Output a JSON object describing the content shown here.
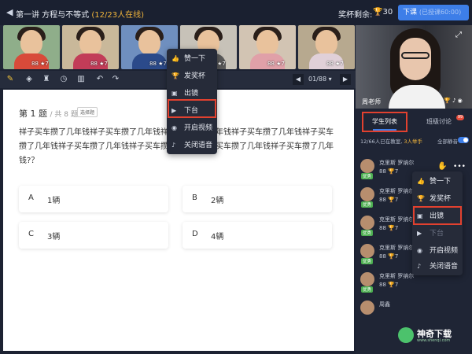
{
  "header": {
    "back_icon": "back-icon",
    "lesson_label": "第一讲 方程与不等式",
    "online_count": "(12/23人在线)",
    "cups_label": "奖杯剩余:",
    "cups_count": "30",
    "end_button": "下课",
    "end_button_sub": "(已授课60:00)"
  },
  "video_strip": {
    "thumbs": [
      {
        "stats": "88 ★7",
        "bg": "#8fae8a",
        "shirt": "#d84a3a"
      },
      {
        "stats": "88 ★7",
        "bg": "#c9b89a",
        "shirt": "#c23c58"
      },
      {
        "stats": "88 ★7",
        "bg": "#6f8fbf",
        "shirt": "#2b4a8a"
      },
      {
        "stats": "88 ★7",
        "bg": "#c7c2b8",
        "shirt": "#5a5a5a"
      },
      {
        "stats": "88 ★7",
        "bg": "#d2c4b3",
        "shirt": "#e0a0a8"
      },
      {
        "stats": "88 ★7",
        "bg": "#b7a98f",
        "shirt": "#e0d0d8"
      }
    ]
  },
  "toolbar": {
    "page_indicator": "01/88"
  },
  "question": {
    "number": "第 1 题",
    "total": "/ 共 8 题",
    "type": "选择题",
    "text": "祥子买车攒了几年钱祥子买车攒了几年钱祥子买车攒了几年钱祥子买车攒了几年钱祥子买车攒了几年钱祥子买车攒了几年钱祥子买车攒了几年钱祥子买车攒了几年钱祥子买车攒了几年钱?？",
    "options": [
      {
        "key": "A",
        "value": "1辆"
      },
      {
        "key": "B",
        "value": "2辆"
      },
      {
        "key": "C",
        "value": "3辆"
      },
      {
        "key": "D",
        "value": "4辆"
      }
    ]
  },
  "center_menu": {
    "items": [
      {
        "icon": "thumbs-up-icon",
        "label": "赞一下"
      },
      {
        "icon": "trophy-icon",
        "label": "发奖杯"
      },
      {
        "icon": "spotlight-icon",
        "label": "出镜"
      },
      {
        "icon": "video-off-icon",
        "label": "下台"
      },
      {
        "icon": "camera-icon",
        "label": "开启视频"
      },
      {
        "icon": "mic-icon",
        "label": "关闭语音"
      }
    ]
  },
  "right_panel": {
    "teacher_name": "周老师",
    "tab_students": "学生列表",
    "tab_discussion": "班级讨论",
    "badge": "99",
    "summary": "12/66人已在教室,",
    "summary_raise": "3人举手",
    "mute_all": "全部静音",
    "students": [
      {
        "name": "克里斯 罗纳尔",
        "tag": "优秀",
        "cnt": "88",
        "cups": "7"
      },
      {
        "name": "克里斯 罗纳尔",
        "tag": "优秀",
        "cnt": "88",
        "cups": "7"
      },
      {
        "name": "克里斯 罗纳尔",
        "tag": "优秀",
        "cnt": "88",
        "cups": "7"
      },
      {
        "name": "克里斯 罗纳尔",
        "tag": "优秀",
        "cnt": "88",
        "cups": "7"
      },
      {
        "name": "克里斯 罗纳尔",
        "tag": "优秀",
        "cnt": "88",
        "cups": "7"
      },
      {
        "name": "周鑫",
        "tag": "",
        "cnt": "",
        "cups": ""
      }
    ],
    "student_menu": {
      "items": [
        {
          "icon": "thumbs-up-icon",
          "label": "赞一下"
        },
        {
          "icon": "trophy-icon",
          "label": "发奖杯"
        },
        {
          "icon": "spotlight-icon",
          "label": "出镜"
        },
        {
          "icon": "video-off-icon",
          "label": "下台"
        },
        {
          "icon": "camera-icon",
          "label": "开启视频"
        },
        {
          "icon": "mic-icon",
          "label": "关闭语音"
        }
      ]
    }
  },
  "watermark": {
    "name": "神奇下载",
    "url": "www.shenqi.com"
  },
  "colors": {
    "accent": "#3d7ee8",
    "highlight": "#e2412f",
    "cup": "#f5b82e"
  }
}
